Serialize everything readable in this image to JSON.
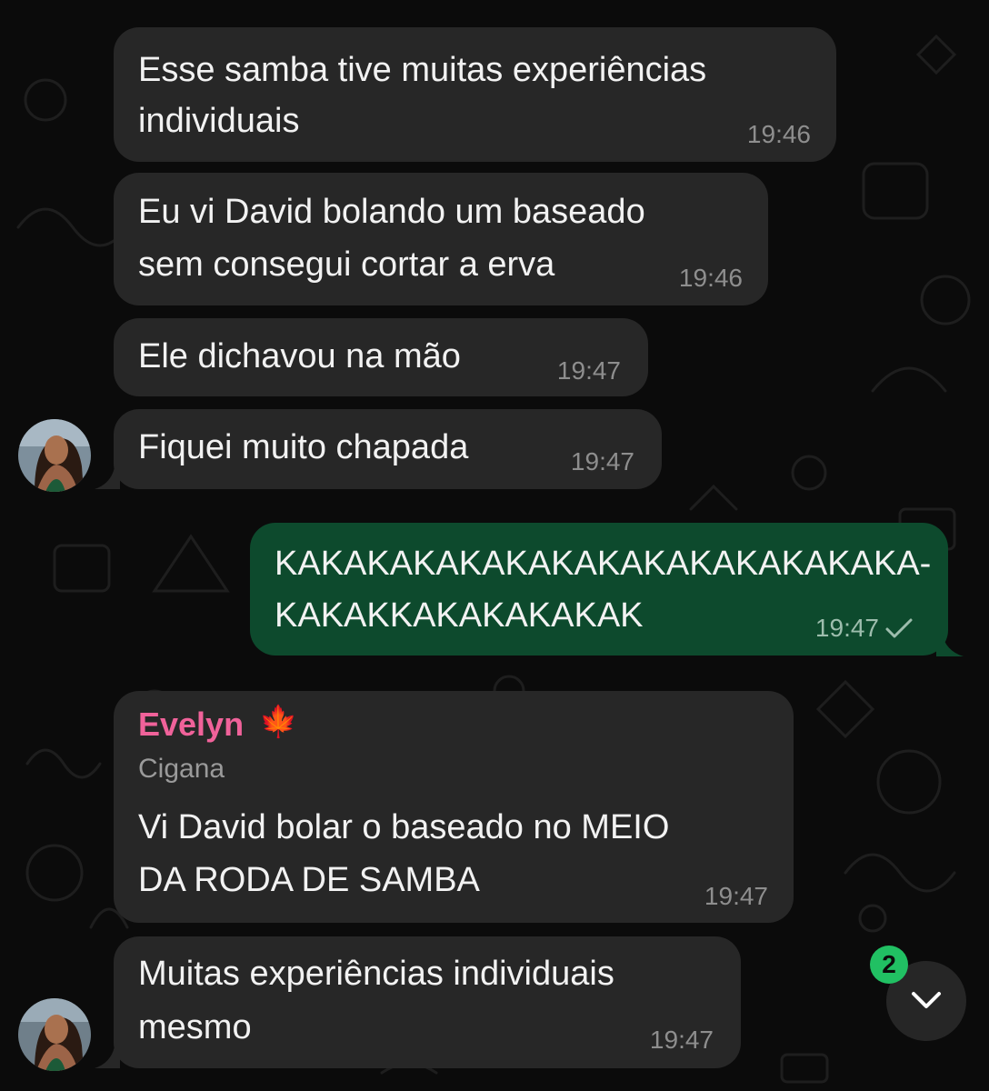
{
  "messages": [
    {
      "lines": [
        "Esse samba tive muitas experiências",
        "individuais"
      ],
      "time": "19:46"
    },
    {
      "lines": [
        "Eu vi David bolando um baseado",
        "sem consegui cortar a erva"
      ],
      "time": "19:46"
    },
    {
      "lines": [
        "Ele dichavou na mão"
      ],
      "time": "19:47"
    },
    {
      "lines": [
        "Fiquei muito chapada"
      ],
      "time": "19:47"
    },
    {
      "lines": [
        "KAKAKAKAKAKAKAKAKAKAKAKAKAKA-",
        "KAKAKKAKAKAKAKAK"
      ],
      "time": "19:47",
      "status_icon": "single-check-icon"
    },
    {
      "sender": "Evelyn",
      "sender_emoji": "🍁",
      "sender_role": "Cigana",
      "lines": [
        "Vi David bolar o baseado no MEIO",
        "DA RODA DE SAMBA"
      ],
      "time": "19:47"
    },
    {
      "lines": [
        "Muitas experiências individuais",
        "mesmo"
      ],
      "time": "19:47"
    }
  ],
  "scroll_button": {
    "icon": "chevron-down-icon",
    "unread_count": "2"
  },
  "colors": {
    "incoming_bubble": "#272727",
    "outgoing_bubble": "#0d4a2d",
    "sender_name": "#f0629a",
    "unread_badge": "#21c063",
    "background": "#0b0b0b"
  }
}
